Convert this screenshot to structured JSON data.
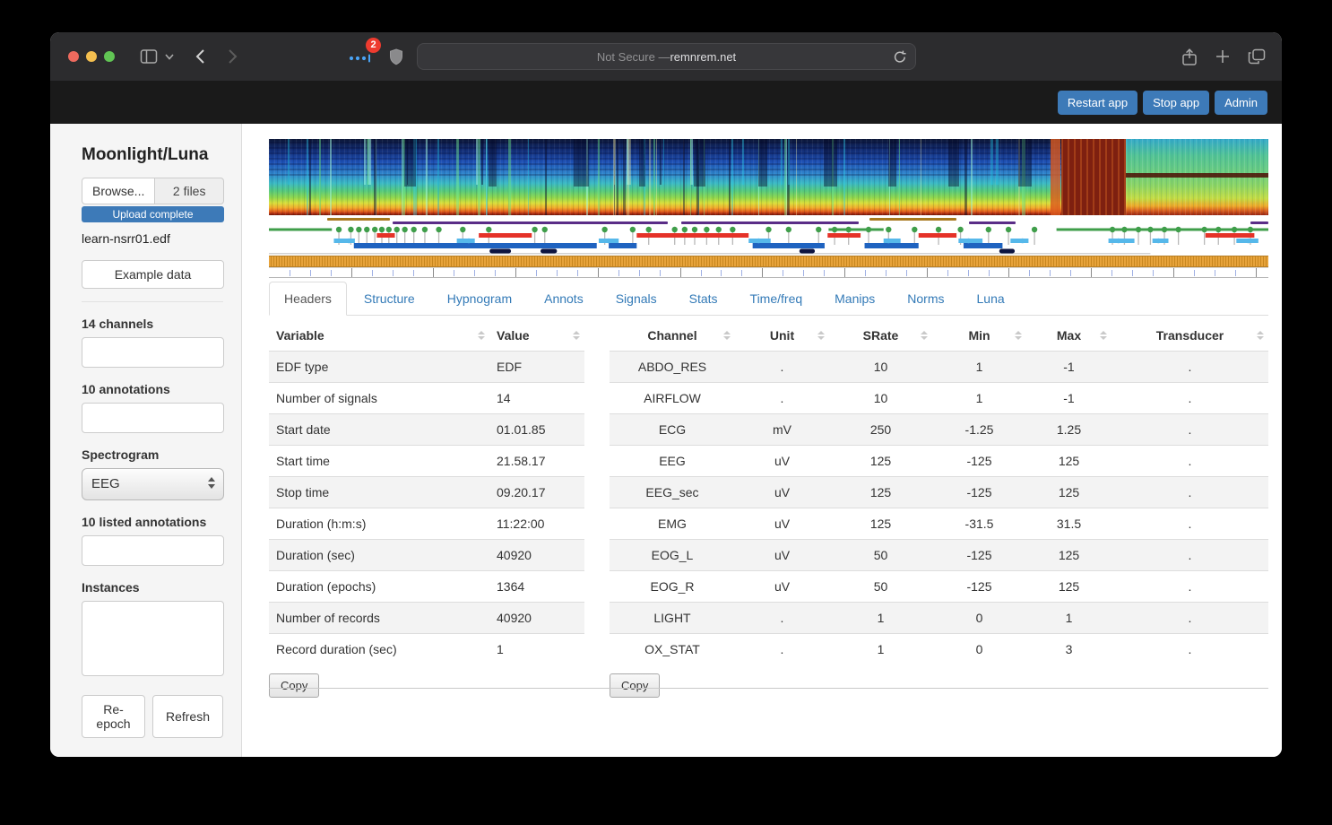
{
  "browser": {
    "address_prefix": "Not Secure — ",
    "address_domain": "remnrem.net",
    "extension_badge": "2"
  },
  "appbar": {
    "restart_label": "Restart app",
    "stop_label": "Stop app",
    "admin_label": "Admin",
    "button_color": "#3d7ab8"
  },
  "sidebar": {
    "title": "Moonlight/Luna",
    "browse_label": "Browse...",
    "files_label": "2 files",
    "upload_status": "Upload complete",
    "filename": "learn-nsrr01.edf",
    "example_button": "Example data",
    "channels_label": "14 channels",
    "annotations_label": "10 annotations",
    "spectrogram_label": "Spectrogram",
    "spectrogram_value": "EEG",
    "listed_annotations_label": "10 listed annotations",
    "instances_label": "Instances",
    "reepoch_button": "Re-epoch",
    "refresh_button": "Refresh"
  },
  "tabs": {
    "active_index": 0,
    "items": [
      "Headers",
      "Structure",
      "Hypnogram",
      "Annots",
      "Signals",
      "Stats",
      "Time/freq",
      "Manips",
      "Norms",
      "Luna"
    ]
  },
  "headers_table": {
    "copy_label": "Copy",
    "columns": [
      "Variable",
      "Value"
    ],
    "rows": [
      [
        "EDF type",
        "EDF"
      ],
      [
        "Number of signals",
        "14"
      ],
      [
        "Start date",
        "01.01.85"
      ],
      [
        "Start time",
        "21.58.17"
      ],
      [
        "Stop time",
        "09.20.17"
      ],
      [
        "Duration (h:m:s)",
        "11:22:00"
      ],
      [
        "Duration (sec)",
        "40920"
      ],
      [
        "Duration (epochs)",
        "1364"
      ],
      [
        "Number of records",
        "40920"
      ],
      [
        "Record duration (sec)",
        "1"
      ]
    ]
  },
  "channels_table": {
    "copy_label": "Copy",
    "columns": [
      "Channel",
      "Unit",
      "SRate",
      "Min",
      "Max",
      "Transducer"
    ],
    "rows": [
      [
        "ABDO_RES",
        ".",
        "10",
        "1",
        "-1",
        "."
      ],
      [
        "AIRFLOW",
        ".",
        "10",
        "1",
        "-1",
        "."
      ],
      [
        "ECG",
        "mV",
        "250",
        "-1.25",
        "1.25",
        "."
      ],
      [
        "EEG",
        "uV",
        "125",
        "-125",
        "125",
        "."
      ],
      [
        "EEG_sec",
        "uV",
        "125",
        "-125",
        "125",
        "."
      ],
      [
        "EMG",
        "uV",
        "125",
        "-31.5",
        "31.5",
        "."
      ],
      [
        "EOG_L",
        "uV",
        "50",
        "-125",
        "125",
        "."
      ],
      [
        "EOG_R",
        "uV",
        "50",
        "-125",
        "125",
        "."
      ],
      [
        "LIGHT",
        ".",
        "1",
        "0",
        "1",
        "."
      ],
      [
        "OX_STAT",
        ".",
        "1",
        "0",
        "3",
        "."
      ]
    ]
  },
  "viz": {
    "spectrogram": {
      "gradient": [
        "#0d1838",
        "#122c72",
        "#1e50b4",
        "#2f86cc",
        "#3ab9c4",
        "#55c97c",
        "#8fd64c",
        "#d8de3a",
        "#f0ad2b",
        "#e2601c",
        "#aa2a10",
        "#6e1606"
      ],
      "red_block": {
        "a": 79.3,
        "b": 85.7,
        "color": "#7e2010"
      },
      "tail": {
        "a": 85.7,
        "b": 100,
        "gradient": [
          "#35aac8",
          "#52c394",
          "#6ccd7e",
          "#8ed562",
          "#c3dc43",
          "#eda828",
          "#d95e1d",
          "#992410"
        ]
      }
    },
    "annotation_bars": [
      {
        "color": "#a8791e",
        "a": 5.8,
        "b": 12.1,
        "row": 0
      },
      {
        "color": "#5a2d87",
        "a": 12.4,
        "b": 39.9,
        "row": 1
      },
      {
        "color": "#5a2d87",
        "a": 41.3,
        "b": 59.0,
        "row": 1
      },
      {
        "color": "#a8791e",
        "a": 60.1,
        "b": 68.8,
        "row": 0
      },
      {
        "color": "#5a2d87",
        "a": 70.0,
        "b": 74.7,
        "row": 1
      },
      {
        "color": "#5a2d87",
        "a": 98.2,
        "b": 100,
        "row": 1
      }
    ],
    "hypnogram": {
      "stage_colors": {
        "W": "#3f9e4a",
        "R": "#e53228",
        "N1": "#56b8ea",
        "N2": "#1f63c0",
        "N3": "#0d1440"
      },
      "stage_levels": {
        "W": 5,
        "R": 11.5,
        "N1": 17.5,
        "N2": 23,
        "N3": 29
      },
      "stem_color": "#b9b9b9",
      "axis_line_end": 88.2,
      "segments": [
        {
          "s": "W",
          "a": 0,
          "b": 6.3
        },
        {
          "s": "W",
          "a": 56,
          "b": 61.5
        },
        {
          "s": "W",
          "a": 78.8,
          "b": 100
        },
        {
          "s": "R",
          "a": 10.8,
          "b": 12.6
        },
        {
          "s": "R",
          "a": 21,
          "b": 26.3
        },
        {
          "s": "R",
          "a": 36.8,
          "b": 48
        },
        {
          "s": "R",
          "a": 55.9,
          "b": 59.2
        },
        {
          "s": "R",
          "a": 65,
          "b": 68.8
        },
        {
          "s": "R",
          "a": 93.7,
          "b": 98.6
        },
        {
          "s": "N1",
          "a": 6.5,
          "b": 8.6
        },
        {
          "s": "N1",
          "a": 18.8,
          "b": 20.6
        },
        {
          "s": "N1",
          "a": 33,
          "b": 35
        },
        {
          "s": "N1",
          "a": 48,
          "b": 50.2
        },
        {
          "s": "N1",
          "a": 61.5,
          "b": 63.2
        },
        {
          "s": "N1",
          "a": 69,
          "b": 71.4
        },
        {
          "s": "N1",
          "a": 74.2,
          "b": 76
        },
        {
          "s": "N1",
          "a": 84,
          "b": 86.6
        },
        {
          "s": "N1",
          "a": 88.4,
          "b": 90
        },
        {
          "s": "N1",
          "a": 96.8,
          "b": 99
        },
        {
          "s": "N2",
          "a": 8.5,
          "b": 32.8
        },
        {
          "s": "N2",
          "a": 34,
          "b": 36.8
        },
        {
          "s": "N2",
          "a": 48.4,
          "b": 55.6
        },
        {
          "s": "N2",
          "a": 59.6,
          "b": 65
        },
        {
          "s": "N2",
          "a": 69.5,
          "b": 73.4
        },
        {
          "s": "N3",
          "a": 22.3,
          "b": 24
        },
        {
          "s": "N3",
          "a": 27.4,
          "b": 28.6
        },
        {
          "s": "N3",
          "a": 53.3,
          "b": 54.4
        },
        {
          "s": "N3",
          "a": 73.3,
          "b": 74.4
        }
      ],
      "arousal_dots": [
        7,
        8.2,
        9,
        9.8,
        10.6,
        11.3,
        12,
        12.8,
        13.6,
        14.5,
        15.6,
        17,
        19.4,
        22,
        26.6,
        27.6,
        33.6,
        36.4,
        38,
        40.6,
        41.6,
        42.6,
        43.8,
        45,
        46.4,
        50,
        52,
        55,
        56.6,
        58,
        60,
        62,
        64.6,
        67,
        69.2,
        72,
        74,
        76.6,
        84.4,
        85.6,
        87,
        88.2,
        89.6,
        91,
        93.6,
        95,
        96.6,
        98.2
      ],
      "n1_dots": [
        8,
        20,
        34,
        49,
        62,
        70,
        75.4,
        85,
        89,
        98
      ]
    },
    "band_color": "#e7a33b",
    "band_stripe": "#c8871f",
    "ruler": {
      "tick_count": 48,
      "major_every": 4,
      "tick_spacing_px": 22.93,
      "minor_color": "#9fb0e4",
      "major_color": "#8a8a8a"
    }
  }
}
